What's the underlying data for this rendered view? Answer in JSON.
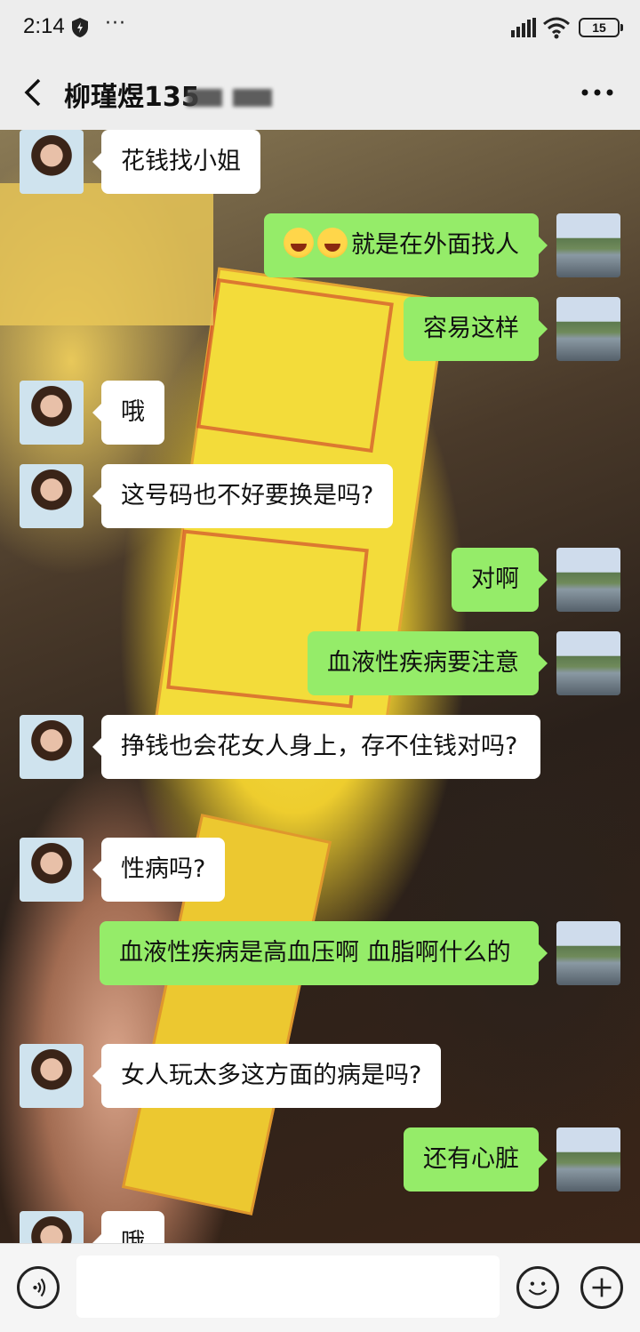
{
  "status_bar": {
    "time": "2:14",
    "extra_icons": "···",
    "battery": "15"
  },
  "header": {
    "title": "柳瑾煜135"
  },
  "messages": [
    {
      "side": "left",
      "text": "花钱找小姐"
    },
    {
      "side": "right",
      "text": "就是在外面找人",
      "emoji_prefix": [
        "laughing-crying-emoji",
        "laughing-crying-emoji"
      ]
    },
    {
      "side": "right",
      "text": "容易这样"
    },
    {
      "side": "left",
      "text": "哦"
    },
    {
      "side": "left",
      "text": "这号码也不好要换是吗?"
    },
    {
      "side": "right",
      "text": "对啊"
    },
    {
      "side": "right",
      "text": "血液性疾病要注意"
    },
    {
      "side": "left",
      "text": "挣钱也会花女人身上，存不住钱对吗?"
    },
    {
      "side": "left",
      "text": "性病吗?"
    },
    {
      "side": "right",
      "text": "血液性疾病是高血压啊 血脂啊什么的"
    },
    {
      "side": "left",
      "text": "女人玩太多这方面的病是吗?"
    },
    {
      "side": "right",
      "text": "还有心脏"
    },
    {
      "side": "left",
      "text": "哦"
    }
  ],
  "input_bar": {
    "placeholder": ""
  },
  "colors": {
    "bubble_right": "#95ec69",
    "bubble_left": "#ffffff",
    "bar_bg": "#ededed"
  }
}
